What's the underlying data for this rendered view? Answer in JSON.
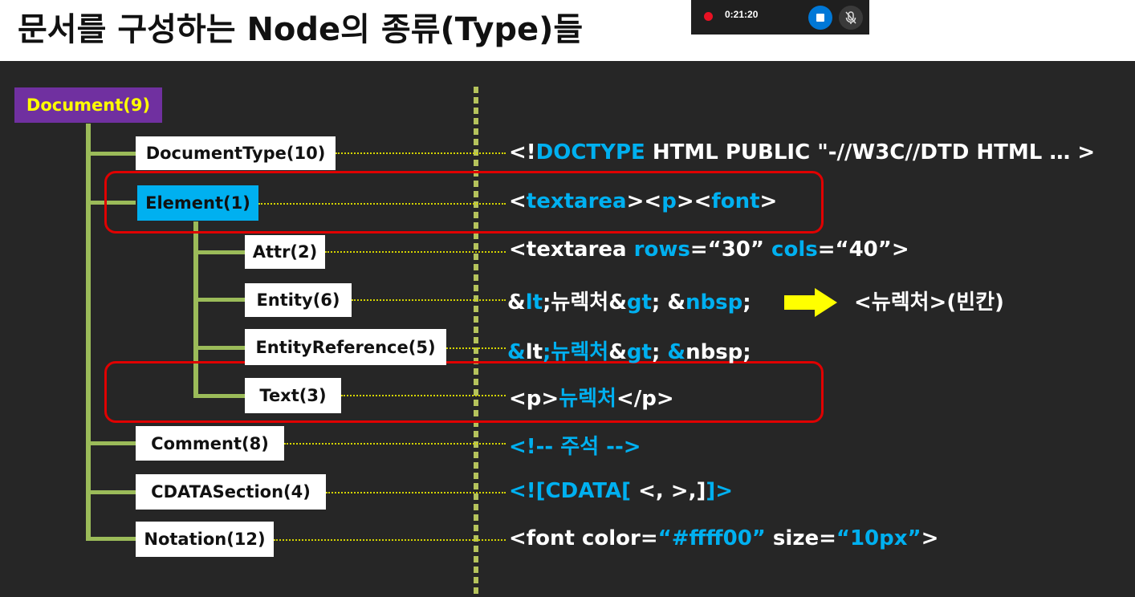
{
  "title": "문서를 구성하는 Node의 종류(Type)들",
  "recorder": {
    "time": "0:21:20",
    "stop_icon": "stop-icon",
    "mic_icon": "mic-muted-icon"
  },
  "colors": {
    "accent_blue": "#00b0f0",
    "tree_green": "#9bbb59",
    "highlight_red": "#e00000",
    "root_purple": "#7030a0",
    "root_text": "#ffff00",
    "arrow_yellow": "#ffff00"
  },
  "nodes": {
    "document": "Document(9)",
    "doctype": "DocumentType(10)",
    "element": "Element(1)",
    "attr": "Attr(2)",
    "entity": "Entity(6)",
    "entityref": "EntityReference(5)",
    "text": "Text(3)",
    "comment": "Comment(8)",
    "cdata": "CDATASection(4)",
    "notation": "Notation(12)"
  },
  "examples": {
    "doctype": [
      "<!",
      "DOCTYPE",
      " HTML PUBLIC \"-//W3C//DTD HTML … >"
    ],
    "element": [
      "<",
      "textarea",
      "><",
      "p",
      "><",
      "font",
      ">"
    ],
    "attr": [
      "<textarea ",
      "rows",
      "=“30” ",
      "cols",
      "=“40”>"
    ],
    "entity": [
      "&",
      "lt",
      ";뉴렉처&",
      "gt",
      "; &",
      "nbsp",
      ";"
    ],
    "entity_result": "<뉴렉처>(빈칸)",
    "entityref": [
      "&",
      "lt",
      ";뉴렉처",
      "&",
      "gt",
      "; ",
      "&",
      "nbsp;"
    ],
    "text": [
      "<p>",
      "뉴렉처",
      "</p>"
    ],
    "comment": "<!-- 주석 -->",
    "cdata": [
      "<![CDATA[",
      " <, >,]",
      "]>"
    ],
    "notation": [
      "<font color=",
      "“#ffff00”",
      " size=",
      "“10px”",
      ">"
    ]
  }
}
